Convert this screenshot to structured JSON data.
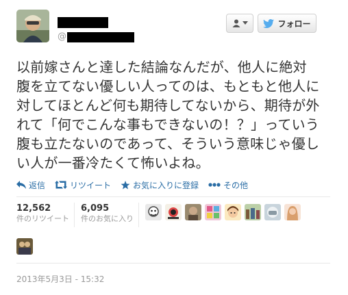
{
  "tweet": {
    "handle_prefix": "@",
    "lines": [
      "以前嫁さんと達した結論なんだが、他人に絶対",
      "腹を立てない優しい人ってのは、もともと他人に",
      "対してほとんど何も期待してないから、期待が外",
      "れて「何でこんな事もできないの！？」っていう",
      "腹も立たないのであって、そういう意味じゃ優し",
      "い人が一番冷たくて怖いよね。"
    ],
    "timestamp": "2013年5月3日 - 15:32"
  },
  "header": {
    "follow_label": "フォロー"
  },
  "actions": {
    "reply": "返信",
    "retweet": "リツイート",
    "favorite": "お気に入りに登録",
    "more": "その他"
  },
  "stats": {
    "retweets_count": "12,562",
    "retweets_label": "件のリツイート",
    "favorites_count": "6,095",
    "favorites_label": "件のお気に入り"
  },
  "colors": {
    "link": "#2a6da5",
    "twitter_blue": "#55acee",
    "muted": "#999999",
    "text": "#333333"
  },
  "icons": [
    "user-icon",
    "twitter-bird-icon",
    "reply-icon",
    "retweet-icon",
    "star-icon",
    "more-icon"
  ]
}
